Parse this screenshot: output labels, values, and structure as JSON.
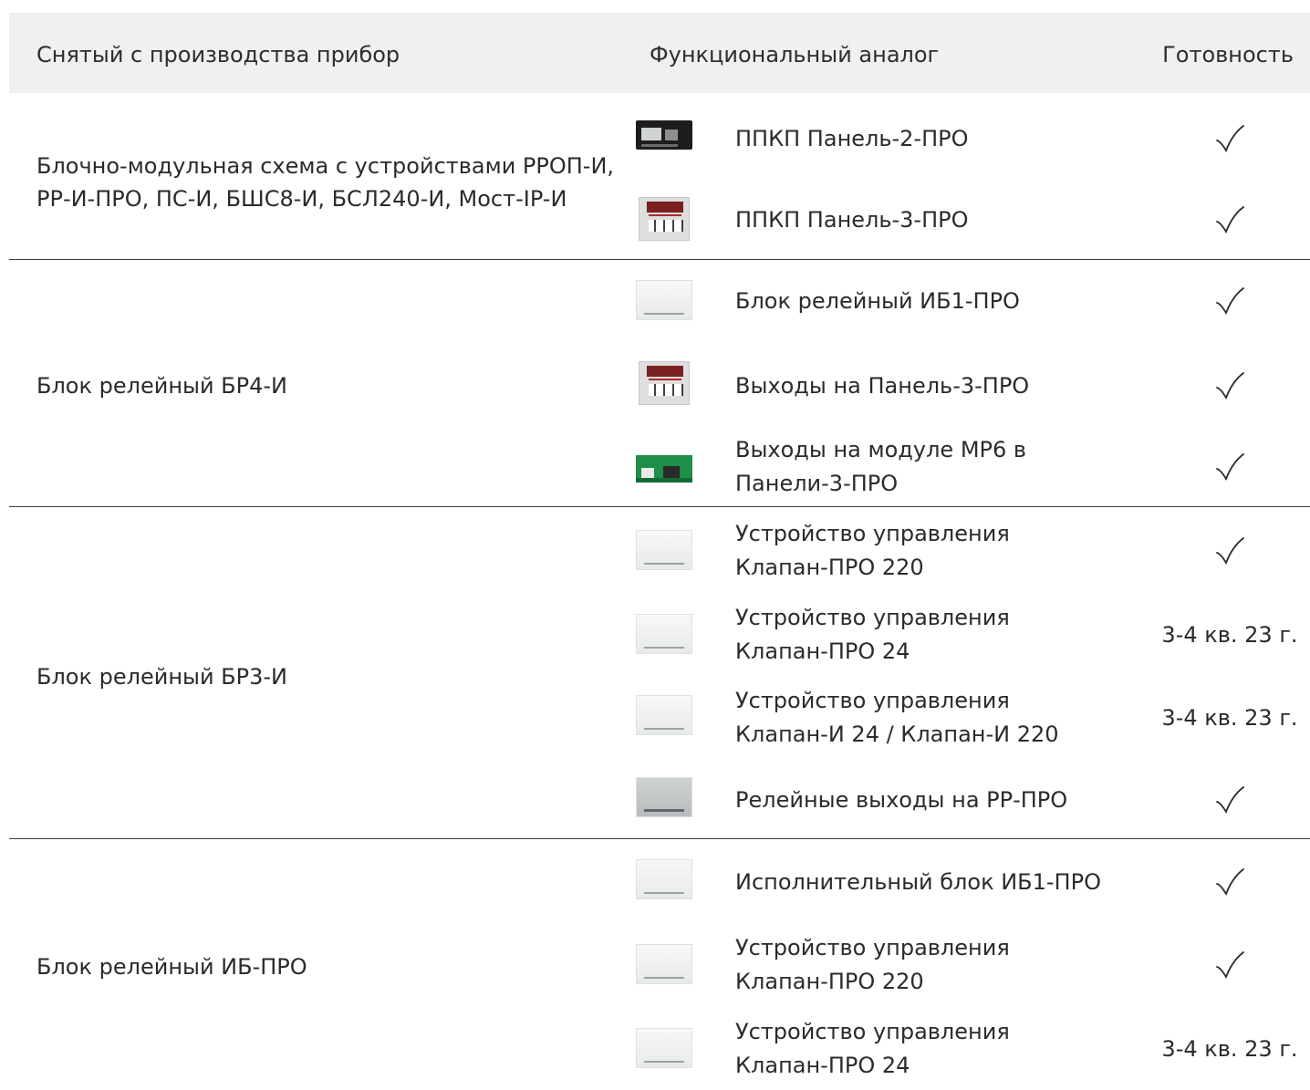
{
  "header": {
    "device": "Снятый с производства прибор",
    "analog": "Функциональный аналог",
    "ready": "Готовность"
  },
  "groups": [
    {
      "label": "Блочно-модульная схема с устройствами РРОП-И, РР-И-ПРО, ПС-И, БШС8-И, БСЛ240-И, Мост-IP-И"
    },
    {
      "label": "Блок релейный БР4-И"
    },
    {
      "label": "Блок релейный БР3-И"
    },
    {
      "label": "Блок релейный ИБ-ПРО"
    }
  ],
  "rows": [
    {
      "name": "ППКП Панель-2-ПРО",
      "ready": "✓",
      "icon": "panel-2-device"
    },
    {
      "name": "ППКП Панель-3-ПРО",
      "ready": "✓",
      "icon": "panel-3-device"
    },
    {
      "name": "Блок релейный ИБ1-ПРО",
      "ready": "✓",
      "icon": "white-box-device"
    },
    {
      "name": "Выходы на Панель-3-ПРО",
      "ready": "✓",
      "icon": "panel-3-device"
    },
    {
      "name": "Выходы на модуле МР6 в\nПанели-3-ПРО",
      "ready": "✓",
      "icon": "circuit-board"
    },
    {
      "name": "Устройство управления\nКлапан-ПРО 220",
      "ready": "✓",
      "icon": "white-box-device"
    },
    {
      "name": "Устройство управления\nКлапан-ПРО 24",
      "ready": "3-4 кв. 23 г.",
      "icon": "white-box-device"
    },
    {
      "name": "Устройство управления\nКлапан-И 24 / Клапан-И 220",
      "ready": "3-4 кв. 23 г.",
      "icon": "white-box-device"
    },
    {
      "name": "Релейные выходы на РР-ПРО",
      "ready": "✓",
      "icon": "grey-box-device"
    },
    {
      "name": "Исполнительный блок ИБ1-ПРО",
      "ready": "✓",
      "icon": "white-box-device"
    },
    {
      "name": "Устройство управления\nКлапан-ПРО 220",
      "ready": "✓",
      "icon": "white-box-device"
    },
    {
      "name": "Устройство управления\nКлапан-ПРО 24",
      "ready": "3-4 кв. 23 г.",
      "icon": "white-box-device"
    }
  ]
}
